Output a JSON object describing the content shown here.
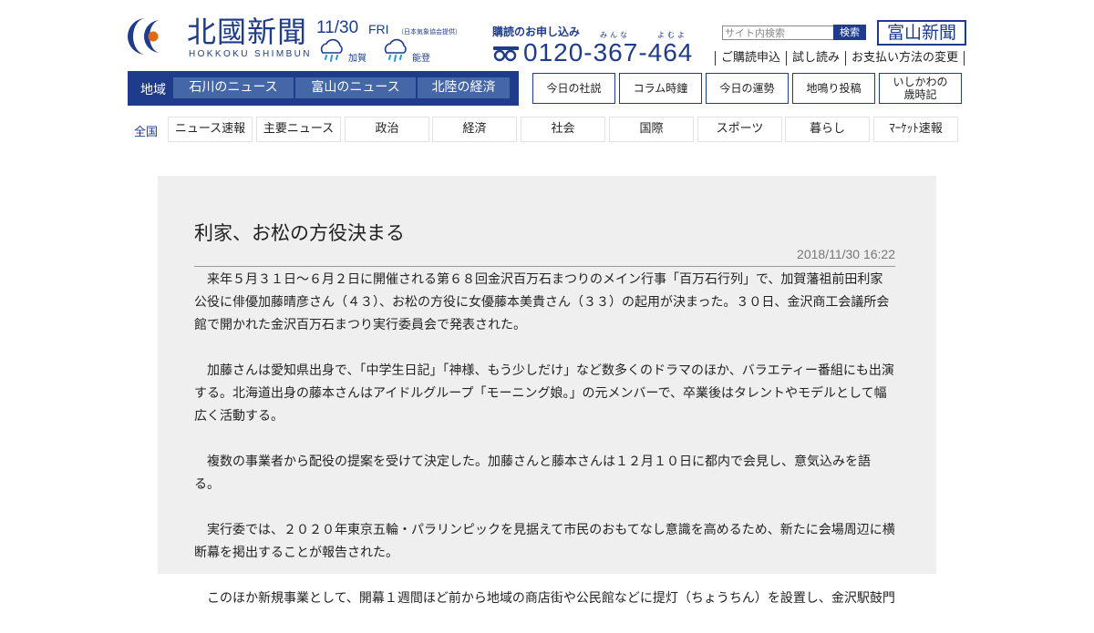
{
  "brand": {
    "title": "北國新聞",
    "subtitle": "HOKKOKU SHIMBUN",
    "sister_paper": "富山新聞",
    "colors": {
      "navy": "#1f3c8c",
      "tab": "#4567a8",
      "logo_orange": "#e06a14",
      "logo_blue": "#1f3c8c"
    }
  },
  "weather": {
    "date": "11/30",
    "day_of_week": "FRI",
    "credit": "（日本気象協会提供）",
    "locations": [
      {
        "name": "加賀",
        "icon": "rain-icon"
      },
      {
        "name": "能登",
        "icon": "rain-icon"
      }
    ]
  },
  "subscription": {
    "label": "購読のお申し込み",
    "ruby_left": "みんな",
    "ruby_right": "よむよ",
    "phone": "0120-367-464",
    "icon": "freedial-icon"
  },
  "search": {
    "placeholder": "サイト内検索",
    "button": "検索"
  },
  "top_links": [
    "ご購読申込",
    "試し読み",
    "お支払い方法の変更"
  ],
  "region": {
    "label": "地域",
    "tabs": [
      "石川のニュース",
      "富山のニュース",
      "北陸の経済"
    ]
  },
  "nav_boxes": [
    {
      "label": "今日の社説"
    },
    {
      "label": "コラム時鐘"
    },
    {
      "label": "今日の運勢"
    },
    {
      "label": "地鳴り投稿"
    },
    {
      "line1": "いしかわの",
      "line2": "歳時記"
    }
  ],
  "categories": {
    "label": "全国",
    "tabs": [
      "ニュース速報",
      "主要ニュース",
      "政治",
      "経済",
      "社会",
      "国際",
      "スポーツ",
      "暮らし",
      "ﾏｰｹｯﾄ速報"
    ]
  },
  "article": {
    "headline": "利家、お松の方役決まる",
    "timestamp": "2018/11/30 16:22",
    "paragraphs": [
      "来年５月３１日～６月２日に開催される第６８回金沢百万石まつりのメイン行事「百万石行列」で、加賀藩祖前田利家公役に俳優加藤晴彦さん（４３）、お松の方役に女優藤本美貴さん（３３）の起用が決まった。３０日、金沢商工会議所会館で開かれた金沢百万石まつり実行委員会で発表された。",
      "加藤さんは愛知県出身で、「中学生日記」「神様、もう少しだけ」など数多くのドラマのほか、バラエティー番組にも出演する。北海道出身の藤本さんはアイドルグループ「モーニング娘。」の元メンバーで、卒業後はタレントやモデルとして幅広く活動する。",
      "複数の事業者から配役の提案を受けて決定した。加藤さんと藤本さんは１２月１０日に都内で会見し、意気込みを語る。",
      "実行委では、２０２０年東京五輪・パラリンピックを見据えて市民のおもてなし意識を高めるため、新たに会場周辺に横断幕を掲出することが報告された。",
      "このほか新規事業として、開幕１週間ほど前から地域の商店街や公民館などに提灯（ちょうちん）を設置し、金沢駅鼓門"
    ]
  }
}
